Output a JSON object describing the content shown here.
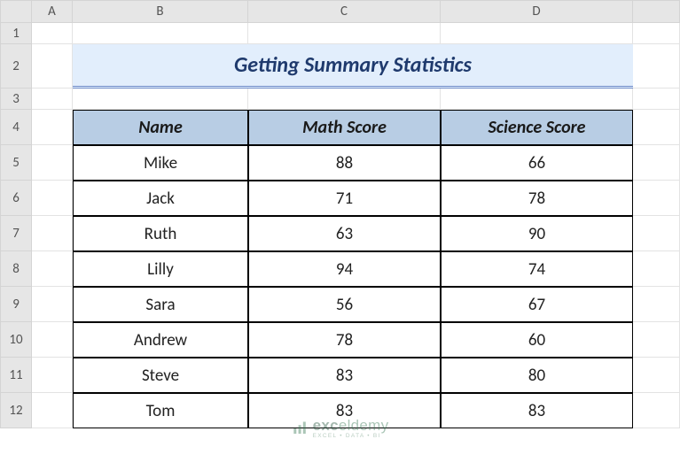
{
  "columns": [
    "A",
    "B",
    "C",
    "D"
  ],
  "rows": [
    "1",
    "2",
    "3",
    "4",
    "5",
    "6",
    "7",
    "8",
    "9",
    "10",
    "11",
    "12"
  ],
  "title": "Getting Summary Statistics",
  "headers": {
    "name": "Name",
    "math": "Math Score",
    "science": "Science Score"
  },
  "data": [
    {
      "name": "Mike",
      "math": "88",
      "science": "66"
    },
    {
      "name": "Jack",
      "math": "71",
      "science": "78"
    },
    {
      "name": "Ruth",
      "math": "63",
      "science": "90"
    },
    {
      "name": "Lilly",
      "math": "94",
      "science": "74"
    },
    {
      "name": "Sara",
      "math": "56",
      "science": "67"
    },
    {
      "name": "Andrew",
      "math": "78",
      "science": "60"
    },
    {
      "name": "Steve",
      "math": "83",
      "science": "80"
    },
    {
      "name": "Tom",
      "math": "83",
      "science": "83"
    }
  ],
  "watermark": {
    "brand_a": "exc",
    "brand_b": "eldemy",
    "tagline": "EXCEL • DATA • BI"
  },
  "chart_data": {
    "type": "table",
    "title": "Getting Summary Statistics",
    "columns": [
      "Name",
      "Math Score",
      "Science Score"
    ],
    "rows": [
      [
        "Mike",
        88,
        66
      ],
      [
        "Jack",
        71,
        78
      ],
      [
        "Ruth",
        63,
        90
      ],
      [
        "Lilly",
        94,
        74
      ],
      [
        "Sara",
        56,
        67
      ],
      [
        "Andrew",
        78,
        60
      ],
      [
        "Steve",
        83,
        80
      ],
      [
        "Tom",
        83,
        83
      ]
    ]
  }
}
